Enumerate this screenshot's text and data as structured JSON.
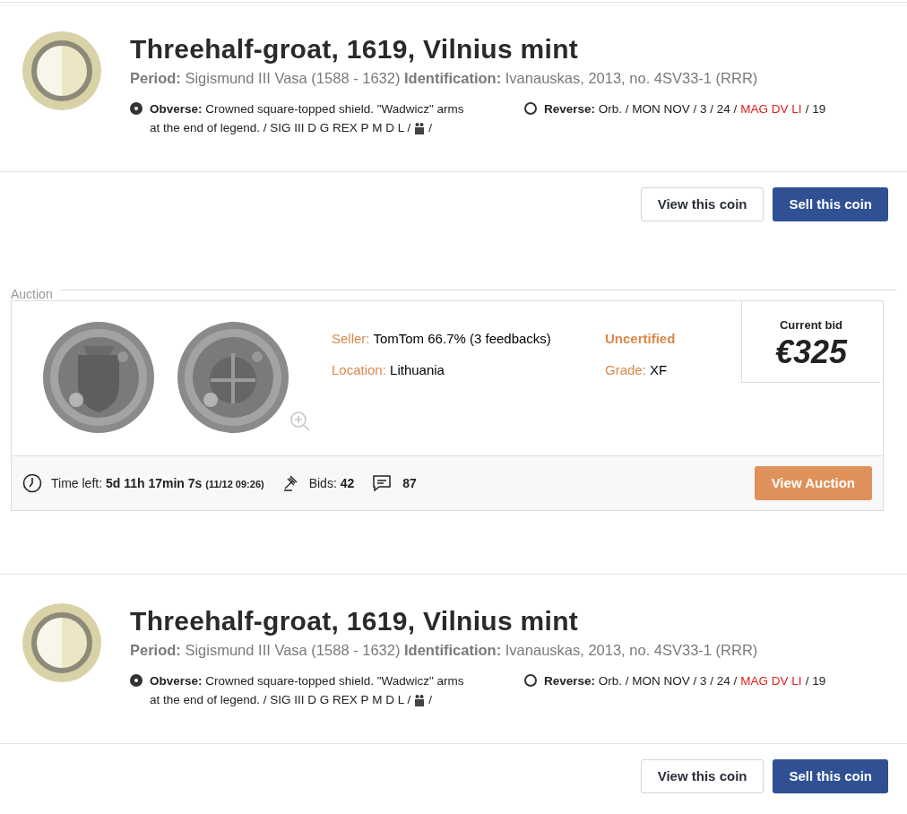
{
  "coins_top": {
    "title": "Threehalf-groat, 1619, Vilnius mint",
    "details": "**Period:** Sigismund III Vasa (1588 - 1632) **Identification:** Ivanauskas, 2013, no. 4SV33-1 (RRR)",
    "sides": [
      {
        "label": "Obverse:",
        "selected": true,
        "parts": [
          {
            "kind": "text",
            "text": "Crowned square-topped shield. \"Wadwicz\" arms"
          },
          {
            "kind": "text",
            "text": "at the end of legend. / SIG III D G REX P M D L /"
          },
          {
            "kind": "symbol"
          },
          {
            "kind": "text",
            "text": "/"
          }
        ]
      },
      {
        "label": "Reverse:",
        "selected": false,
        "parts": [
          {
            "kind": "text",
            "text": "Orb. / MON NOV / 3 / 24 /"
          },
          {
            "kind": "highlight",
            "text": "MAG DV LI"
          },
          {
            "kind": "text",
            "text": "/ 19"
          }
        ]
      }
    ],
    "buttons": [
      {
        "label": "View this coin",
        "kind": "secondary"
      },
      {
        "label": "Sell this coin",
        "kind": "primary"
      }
    ]
  },
  "auction": {
    "section_label": "Auction",
    "seller_label": "Seller:",
    "seller": "TomTom 66.7% (3 feedbacks)",
    "location_label": "Location:",
    "location": "Lithuania",
    "certification": "Uncertified",
    "grade_label": "Grade:",
    "grade": "XF",
    "bid_label": "Current bid",
    "bid": "€325",
    "time_label": "Time left:",
    "time_left": "5d 11h 17min 7s",
    "time_end": "(11/12 09:26)",
    "bids_label": "Bids:",
    "bids": "42",
    "comments": "87",
    "button": "View Auction"
  },
  "coins_bottom": {
    "title": "Threehalf-groat, 1619, Vilnius mint",
    "details": "**Period:** Sigismund III Vasa (1588 - 1632) **Identification:** Ivanauskas, 2013, no. 4SV33-1 (RRR)",
    "sides": [
      {
        "label": "Obverse:",
        "selected": true,
        "parts": [
          {
            "kind": "text",
            "text": "Crowned square-topped shield. \"Wadwicz\" arms"
          },
          {
            "kind": "text",
            "text": "at the end of legend. / SIG III D G REX P M D L /"
          },
          {
            "kind": "symbol"
          },
          {
            "kind": "text",
            "text": "/"
          }
        ]
      },
      {
        "label": "Reverse:",
        "selected": false,
        "parts": [
          {
            "kind": "text",
            "text": "Orb. / MON NOV / 3 / 24 /"
          },
          {
            "kind": "highlight",
            "text": "MAG DV LI"
          },
          {
            "kind": "text",
            "text": "/ 19"
          }
        ]
      }
    ],
    "buttons": [
      {
        "label": "View this coin",
        "kind": "secondary"
      },
      {
        "label": "Sell this coin",
        "kind": "primary"
      }
    ]
  }
}
